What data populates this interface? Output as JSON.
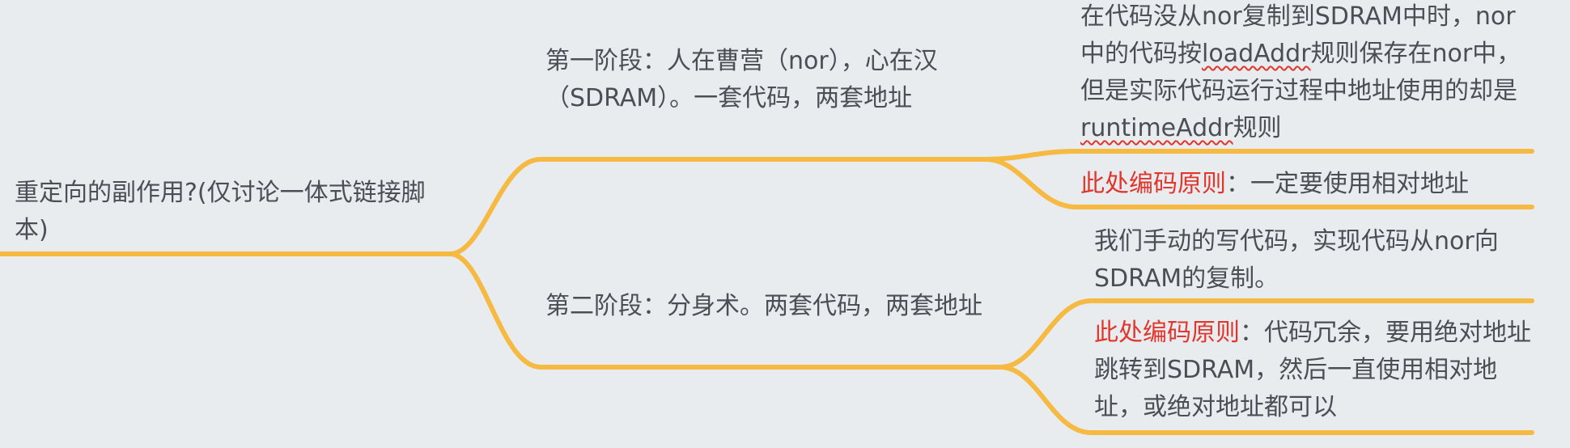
{
  "colors": {
    "branch": "#f6b942",
    "text": "#4a4f55",
    "highlight": "#e0362c",
    "background": "#e9ecef"
  },
  "root": {
    "text": "重定向的副作用?(仅讨论一体式链接脚本)"
  },
  "stage1": {
    "text": "第一阶段：人在曹营（nor），心在汉（SDRAM）。一套代码，两套地址",
    "leaf1": {
      "part1": "在代码没从nor复制到SDRAM中时，nor中的代码按",
      "term1": "loadAddr",
      "part2": "规则保存在nor中，但是实际代码运行过程中地址使用的却是",
      "term2": "runtimeAddr",
      "part3": "规则"
    },
    "leaf2": {
      "label": "此处编码原则",
      "text": "：一定要使用相对地址"
    }
  },
  "stage2": {
    "text": "第二阶段：分身术。两套代码，两套地址",
    "leaf1": {
      "text": "我们手动的写代码，实现代码从nor向SDRAM的复制。"
    },
    "leaf2": {
      "label": "此处编码原则",
      "text": "：代码冗余，要用绝对地址跳转到SDRAM，然后一直使用相对地址，或绝对地址都可以"
    }
  }
}
